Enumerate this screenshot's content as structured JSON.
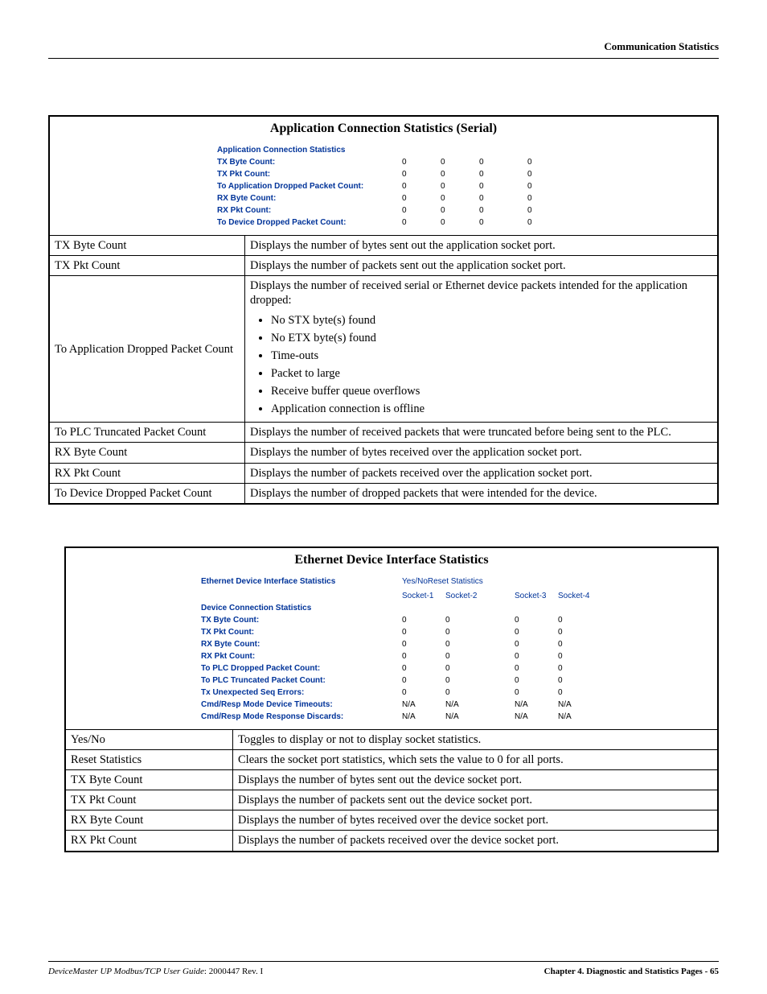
{
  "header": {
    "section_label": "Communication Statistics"
  },
  "table1": {
    "title": "Application Connection Statistics (Serial)",
    "ss_header": "Application Connection Statistics",
    "ss_rows": [
      {
        "label": "TX Byte Count:",
        "v": [
          "0",
          "0",
          "0",
          "0"
        ]
      },
      {
        "label": "TX Pkt Count:",
        "v": [
          "0",
          "0",
          "0",
          "0"
        ]
      },
      {
        "label": "To Application Dropped Packet Count:",
        "v": [
          "0",
          "0",
          "0",
          "0"
        ]
      },
      {
        "label": "RX Byte Count:",
        "v": [
          "0",
          "0",
          "0",
          "0"
        ]
      },
      {
        "label": "RX Pkt Count:",
        "v": [
          "0",
          "0",
          "0",
          "0"
        ]
      },
      {
        "label": "To Device Dropped Packet Count:",
        "v": [
          "0",
          "0",
          "0",
          "0"
        ]
      }
    ],
    "rows": {
      "r1": {
        "l": "TX Byte Count",
        "d": "Displays the number of bytes sent out the application socket port."
      },
      "r2": {
        "l": "TX Pkt Count",
        "d": "Displays the number of packets sent out the application socket port."
      },
      "r3": {
        "l": "To Application Dropped Packet Count",
        "intro": "Displays the number of received serial or Ethernet device packets intended for the application dropped:",
        "items": [
          "No STX byte(s) found",
          "No ETX byte(s) found",
          "Time-outs",
          "Packet to large",
          "Receive buffer queue overflows",
          "Application connection is offline"
        ]
      },
      "r4": {
        "l": "To PLC Truncated Packet Count",
        "d": "Displays the number of received packets that were truncated before being sent to the PLC."
      },
      "r5": {
        "l": "RX Byte Count",
        "d": "Displays the number of bytes received over the application socket port."
      },
      "r6": {
        "l": "RX Pkt Count",
        "d": "Displays the number of packets received over the application socket port."
      },
      "r7": {
        "l": "To Device Dropped Packet Count",
        "d": "Displays the number of dropped packets that were intended for the device."
      }
    }
  },
  "table2": {
    "title": "Ethernet Device Interface Statistics",
    "ss_header": "Ethernet Device Interface Statistics",
    "btn_yesno": "Yes/No",
    "btn_reset": "Reset Statistics",
    "sock_headers": [
      "Socket-1",
      "Socket-2",
      "Socket-3",
      "Socket-4"
    ],
    "sub_header": "Device Connection Statistics",
    "ss_rows": [
      {
        "label": "TX Byte Count:",
        "v": [
          "0",
          "0",
          "0",
          "0"
        ]
      },
      {
        "label": "TX Pkt Count:",
        "v": [
          "0",
          "0",
          "0",
          "0"
        ]
      },
      {
        "label": "RX Byte Count:",
        "v": [
          "0",
          "0",
          "0",
          "0"
        ]
      },
      {
        "label": "RX Pkt Count:",
        "v": [
          "0",
          "0",
          "0",
          "0"
        ]
      },
      {
        "label": "To PLC Dropped Packet Count:",
        "v": [
          "0",
          "0",
          "0",
          "0"
        ]
      },
      {
        "label": "To PLC Truncated Packet Count:",
        "v": [
          "0",
          "0",
          "0",
          "0"
        ]
      },
      {
        "label": "Tx Unexpected Seq Errors:",
        "v": [
          "0",
          "0",
          "0",
          "0"
        ]
      },
      {
        "label": "Cmd/Resp Mode Device Timeouts:",
        "v": [
          "N/A",
          "N/A",
          "N/A",
          "N/A"
        ]
      },
      {
        "label": "Cmd/Resp Mode Response Discards:",
        "v": [
          "N/A",
          "N/A",
          "N/A",
          "N/A"
        ]
      }
    ],
    "rows": {
      "r1": {
        "l": "Yes/No",
        "d": "Toggles to display or not to display socket statistics."
      },
      "r2": {
        "l": "Reset Statistics",
        "d": "Clears the socket port statistics, which sets the value to 0 for all ports."
      },
      "r3": {
        "l": "TX Byte Count",
        "d": "Displays the number of bytes sent out the device socket port."
      },
      "r4": {
        "l": "TX Pkt Count",
        "d": "Displays the number of packets sent out the device socket port."
      },
      "r5": {
        "l": "RX Byte Count",
        "d": "Displays the number of bytes received over the device socket port."
      },
      "r6": {
        "l": "RX Pkt Count",
        "d": "Displays the number of packets received over the device socket port."
      }
    }
  },
  "footer": {
    "left_title": "DeviceMaster UP Modbus/TCP User Guide",
    "left_rev": ": 2000447 Rev. I",
    "right": "Chapter 4. Diagnostic and Statistics Pages - 65"
  }
}
